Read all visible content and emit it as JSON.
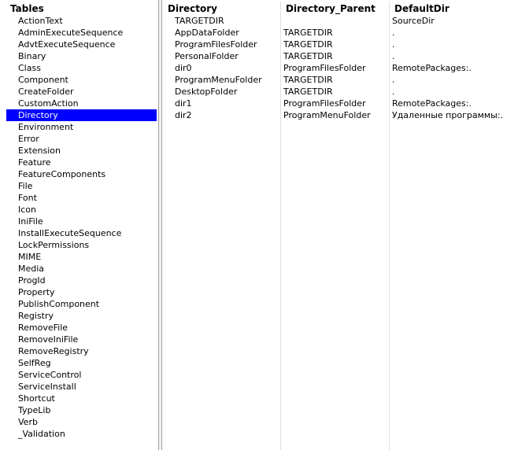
{
  "tables_pane": {
    "header": "Tables",
    "items": [
      "ActionText",
      "AdminExecuteSequence",
      "AdvtExecuteSequence",
      "Binary",
      "Class",
      "Component",
      "CreateFolder",
      "CustomAction",
      "Directory",
      "Environment",
      "Error",
      "Extension",
      "Feature",
      "FeatureComponents",
      "File",
      "Font",
      "Icon",
      "IniFile",
      "InstallExecuteSequence",
      "LockPermissions",
      "MIME",
      "Media",
      "ProgId",
      "Property",
      "PublishComponent",
      "Registry",
      "RemoveFile",
      "RemoveIniFile",
      "RemoveRegistry",
      "SelfReg",
      "ServiceControl",
      "ServiceInstall",
      "Shortcut",
      "TypeLib",
      "Verb",
      "_Validation"
    ],
    "selected": "Directory",
    "selection_color": "#0000ff"
  },
  "grid": {
    "columns": [
      "Directory",
      "Directory_Parent",
      "DefaultDir"
    ],
    "rows": [
      [
        "TARGETDIR",
        "",
        "SourceDir"
      ],
      [
        "AppDataFolder",
        "TARGETDIR",
        "."
      ],
      [
        "ProgramFilesFolder",
        "TARGETDIR",
        "."
      ],
      [
        "PersonalFolder",
        "TARGETDIR",
        "."
      ],
      [
        "dir0",
        "ProgramFilesFolder",
        "RemotePackages:."
      ],
      [
        "ProgramMenuFolder",
        "TARGETDIR",
        "."
      ],
      [
        "DesktopFolder",
        "TARGETDIR",
        "."
      ],
      [
        "dir1",
        "ProgramFilesFolder",
        "RemotePackages:."
      ],
      [
        "dir2",
        "ProgramMenuFolder",
        "Удаленные программы:."
      ]
    ]
  }
}
